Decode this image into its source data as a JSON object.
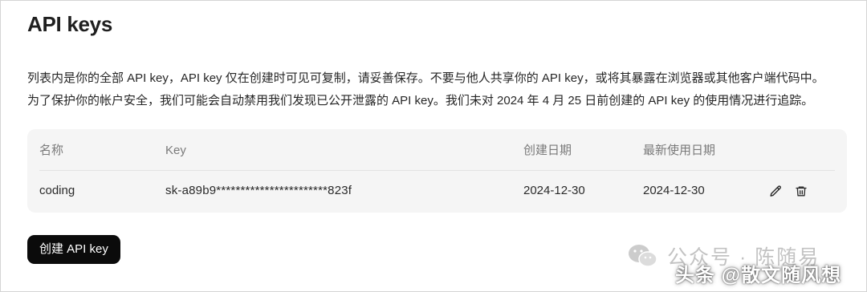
{
  "page": {
    "title": "API keys",
    "description": [
      "列表内是你的全部 API key，API key 仅在创建时可见可复制，请妥善保存。不要与他人共享你的 API key，或将其暴露在浏览器或其他客户端代码中。",
      "为了保护你的帐户安全，我们可能会自动禁用我们发现已公开泄露的 API key。我们未对 2024 年 4 月 25 日前创建的 API key 的使用情况进行追踪。"
    ]
  },
  "table": {
    "headers": {
      "name": "名称",
      "key": "Key",
      "created": "创建日期",
      "last_used": "最新使用日期"
    },
    "rows": [
      {
        "name": "coding",
        "key": "sk-a89b9***********************823f",
        "created": "2024-12-30",
        "last_used": "2024-12-30",
        "edit_icon": "pencil-icon",
        "delete_icon": "trash-icon"
      }
    ]
  },
  "actions": {
    "create_label": "创建 API key"
  },
  "watermark": {
    "public_account": "公众号 · 陈随易",
    "overlay": "头条 @散文随风想"
  },
  "colors": {
    "primary_button": "#0b0b0b",
    "table_background": "#f5f5f5",
    "header_text": "#7a7a7a"
  }
}
